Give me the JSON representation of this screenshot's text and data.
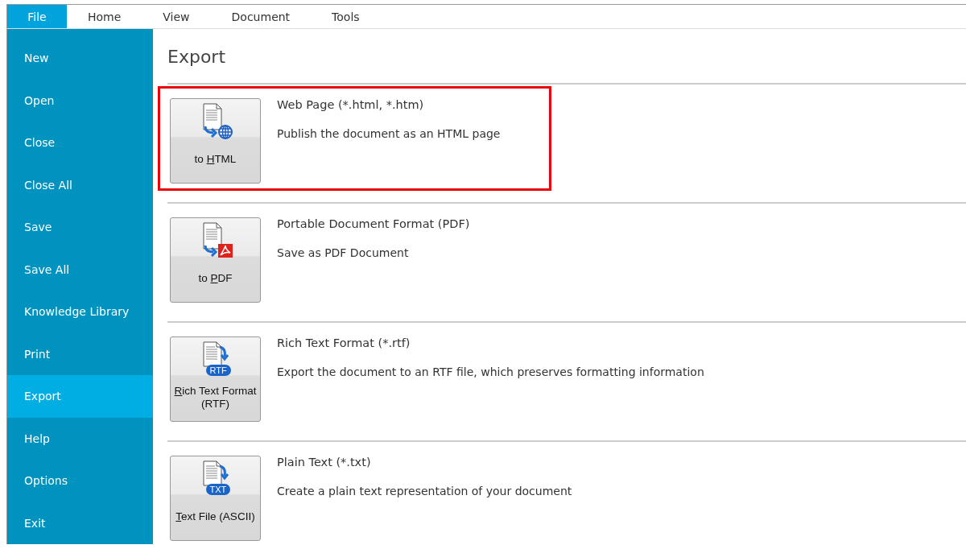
{
  "menu_tabs": [
    {
      "label": "File",
      "selected": true
    },
    {
      "label": "Home",
      "selected": false
    },
    {
      "label": "View",
      "selected": false
    },
    {
      "label": "Document",
      "selected": false
    },
    {
      "label": "Tools",
      "selected": false
    }
  ],
  "sidebar": {
    "items": [
      {
        "label": "New",
        "selected": false
      },
      {
        "label": "Open",
        "selected": false
      },
      {
        "label": "Close",
        "selected": false
      },
      {
        "label": "Close All",
        "selected": false
      },
      {
        "label": "Save",
        "selected": false
      },
      {
        "label": "Save All",
        "selected": false
      },
      {
        "label": "Knowledge Library",
        "selected": false
      },
      {
        "label": "Print",
        "selected": false
      },
      {
        "label": "Export",
        "selected": true
      },
      {
        "label": "Help",
        "selected": false
      },
      {
        "label": "Options",
        "selected": false
      },
      {
        "label": "Exit",
        "selected": false
      }
    ]
  },
  "page_title": "Export",
  "options": [
    {
      "kind": "html",
      "highlighted": true,
      "button": {
        "before": "to ",
        "key": "H",
        "after": "TML"
      },
      "title": "Web Page (*.html, *.htm)",
      "description": "Publish the document as an HTML page"
    },
    {
      "kind": "pdf",
      "highlighted": false,
      "button": {
        "before": "to ",
        "key": "P",
        "after": "DF"
      },
      "title": "Portable Document Format (PDF)",
      "description": "Save as PDF Document"
    },
    {
      "kind": "badge",
      "badge": "RTF",
      "highlighted": false,
      "button": {
        "key": "R",
        "after": "ich Text Format (RTF)"
      },
      "title": "Rich Text Format (*.rtf)",
      "description": "Export the document to an RTF file, which preserves formatting information"
    },
    {
      "kind": "badge",
      "badge": "TXT",
      "highlighted": false,
      "button": {
        "key": "T",
        "after": "ext File (ASCII)"
      },
      "title": "Plain Text (*.txt)",
      "description": "Create a plain text representation of your document"
    }
  ]
}
